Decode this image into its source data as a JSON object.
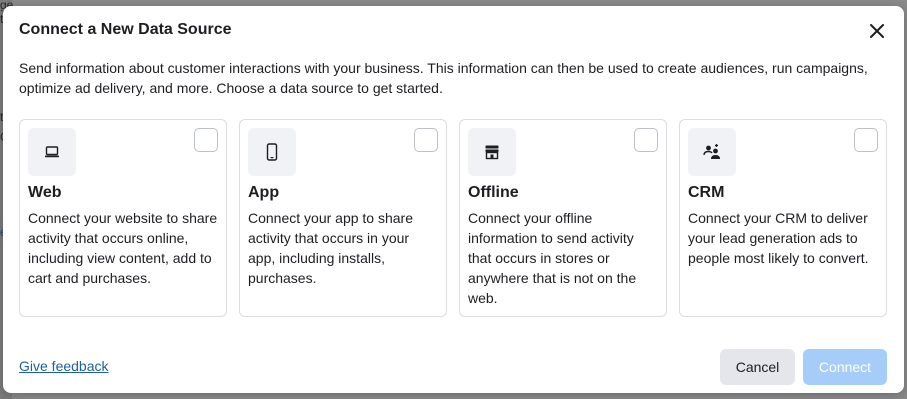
{
  "background": {
    "fragments": [
      "ge to",
      "t",
      "C",
      "e"
    ]
  },
  "modal": {
    "title": "Connect a New Data Source",
    "description": "Send information about customer interactions with your business. This information can then be used to create audiences, run campaigns, optimize ad delivery, and more. Choose a data source to get started.",
    "close_icon": "close-icon"
  },
  "cards": [
    {
      "icon": "laptop-icon",
      "title": "Web",
      "description": "Connect your website to share activity that occurs online, including view content, add to cart and purchases.",
      "selected": false
    },
    {
      "icon": "phone-icon",
      "title": "App",
      "description": "Connect your app to share activity that occurs in your app, including installs, purchases.",
      "selected": false
    },
    {
      "icon": "store-icon",
      "title": "Offline",
      "description": "Connect your offline information to send activity that occurs in stores or anywhere that is not on the web.",
      "selected": false
    },
    {
      "icon": "crm-people-icon",
      "title": "CRM",
      "description": "Connect your CRM to deliver your lead generation ads to people most likely to convert.",
      "selected": false
    }
  ],
  "footer": {
    "feedback_label": "Give feedback",
    "cancel_label": "Cancel",
    "connect_label": "Connect",
    "connect_disabled": true
  },
  "colors": {
    "link": "#1d5f9f",
    "connect_disabled_bg": "#a5cdf7",
    "card_border": "#dadde1",
    "icon_bg": "#f0f2f5"
  }
}
